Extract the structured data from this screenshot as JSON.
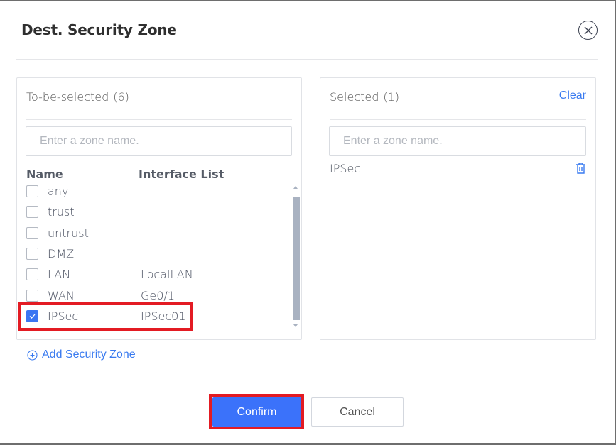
{
  "dialog": {
    "title": "Dest. Security Zone",
    "close_icon": "close-circle-icon"
  },
  "left_panel": {
    "heading": "To-be-selected",
    "count": "(6)",
    "search_placeholder": "Enter a zone name.",
    "search_value": "",
    "columns": {
      "name": "Name",
      "interface": "Interface List"
    },
    "rows": [
      {
        "name": "any",
        "interface": "",
        "checked": false
      },
      {
        "name": "trust",
        "interface": "",
        "checked": false
      },
      {
        "name": "untrust",
        "interface": "",
        "checked": false
      },
      {
        "name": "DMZ",
        "interface": "",
        "checked": false
      },
      {
        "name": "LAN",
        "interface": "LocalLAN",
        "checked": false
      },
      {
        "name": "WAN",
        "interface": "Ge0/1",
        "checked": false
      },
      {
        "name": "IPSec",
        "interface": "IPSec01",
        "checked": true
      }
    ]
  },
  "right_panel": {
    "heading": "Selected",
    "count": "(1)",
    "clear_label": "Clear",
    "search_placeholder": "Enter a zone name.",
    "search_value": "",
    "items": [
      {
        "name": "IPSec",
        "delete_icon": "trash-icon"
      }
    ]
  },
  "add_zone": {
    "label": "Add Security Zone",
    "icon": "plus-circle-icon"
  },
  "footer": {
    "confirm_label": "Confirm",
    "cancel_label": "Cancel"
  },
  "colors": {
    "accent": "#3b72fa",
    "link": "#3a7bf0",
    "highlight": "#e31b23",
    "scrollbar": "#a9b2c1"
  }
}
